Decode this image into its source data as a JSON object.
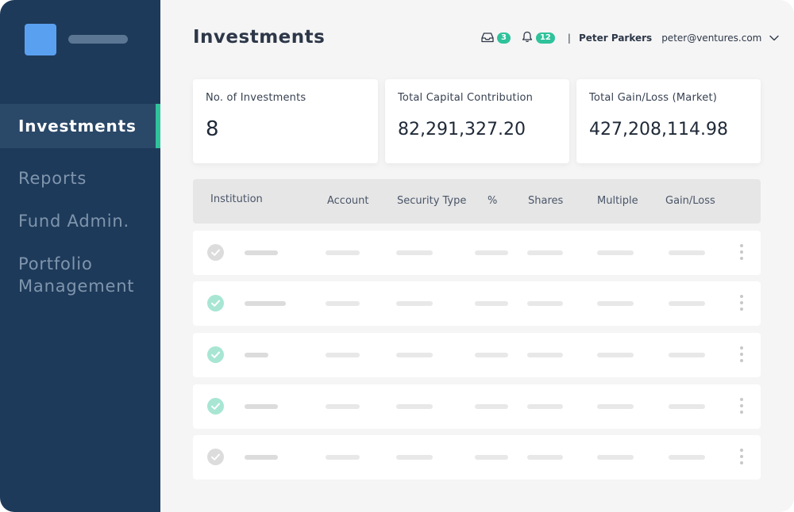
{
  "sidebar": {
    "items": [
      {
        "label": "Investments",
        "active": true
      },
      {
        "label": "Reports"
      },
      {
        "label": "Fund Admin."
      },
      {
        "label": "Portfolio"
      },
      {
        "label": "Management"
      }
    ]
  },
  "header": {
    "title": "Investments",
    "inbox_count": "3",
    "notification_count": "12",
    "separator": "|",
    "user_name": "Peter Parkers",
    "user_email": "peter@ventures.com"
  },
  "cards": [
    {
      "label": "No. of Investments",
      "value": "8"
    },
    {
      "label": "Total Capital Contribution",
      "value": "82,291,327.20"
    },
    {
      "label": "Total Gain/Loss (Market)",
      "value": "427,208,114.98"
    }
  ],
  "table": {
    "columns": [
      "Institution",
      "Account",
      "Security Type",
      "%",
      "Shares",
      "Multiple",
      "Gain/Loss"
    ],
    "rows": [
      {
        "status": "inactive"
      },
      {
        "status": "done"
      },
      {
        "status": "done"
      },
      {
        "status": "done"
      },
      {
        "status": "inactive"
      }
    ]
  },
  "colors": {
    "sidebar": "#1e3a5a",
    "accent": "#2fc29b",
    "check_done": "#a8e6d3",
    "check_inactive": "#dcdcdc"
  }
}
